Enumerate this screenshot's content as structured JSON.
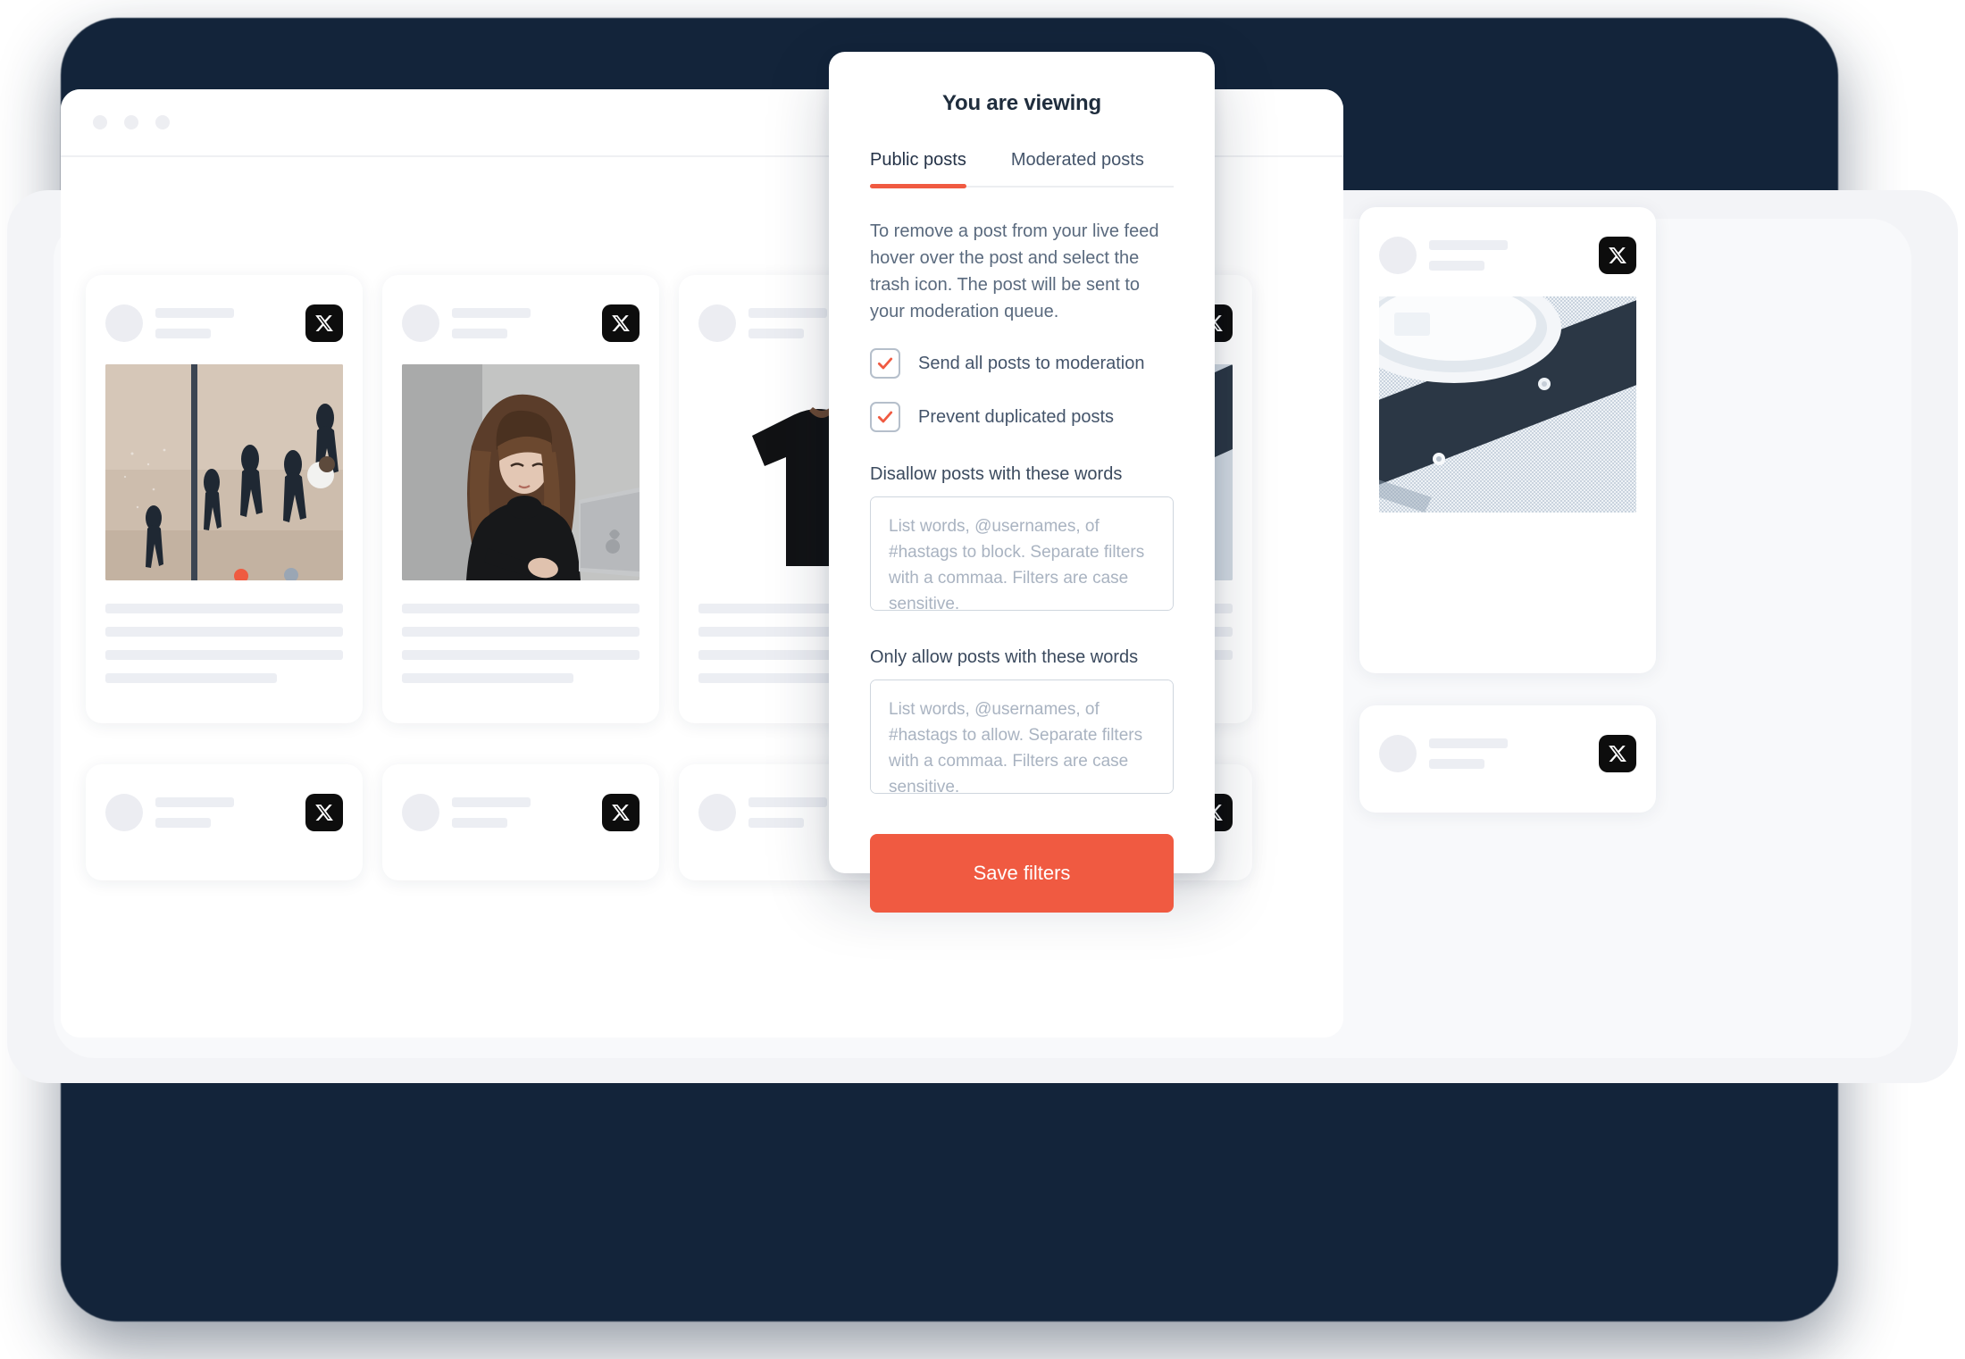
{
  "frame": {
    "accent_color": "#f05a41",
    "dark_frame_color": "#13243a"
  },
  "browser": {
    "traffic_lights": [
      "dot-1",
      "dot-2",
      "dot-3"
    ]
  },
  "feed": {
    "network_icon": "x-logo-icon",
    "cards": [
      {
        "photo": "people-walking-crosswalk-aerial"
      },
      {
        "photo": "woman-with-laptop"
      },
      {
        "photo": "black-tshirt-on-white"
      },
      {
        "photo": "dress-shirts-flatlay"
      }
    ]
  },
  "modal": {
    "title": "You are viewing",
    "tabs": [
      {
        "label": "Public posts",
        "active": true
      },
      {
        "label": "Moderated posts",
        "active": false
      }
    ],
    "description": "To remove a post from your live feed hover over the post and select the trash icon. The post will be sent to your moderation queue.",
    "checkboxes": [
      {
        "label": "Send all posts to moderation",
        "checked": true
      },
      {
        "label": "Prevent duplicated posts",
        "checked": true
      }
    ],
    "fields": [
      {
        "label": "Disallow posts with these words",
        "value": "",
        "placeholder": "List words, @usernames, of #hastags to block. Separate filters with a commaa. Filters are case sensitive."
      },
      {
        "label": "Only allow posts with these words",
        "value": "",
        "placeholder": "List words, @usernames, of #hastags to allow. Separate filters with a commaa. Filters are case sensitive."
      }
    ],
    "save_label": "Save filters"
  }
}
